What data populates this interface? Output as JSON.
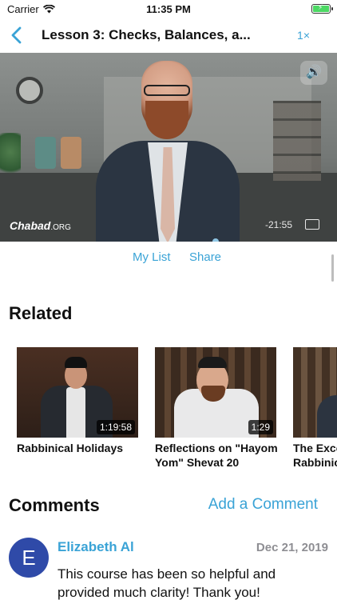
{
  "status_bar": {
    "carrier": "Carrier",
    "time": "11:35 PM",
    "icons": [
      "wifi-icon",
      "battery-charging-icon"
    ],
    "battery_color": "#4cd964"
  },
  "nav": {
    "title": "Lesson 3: Checks, Balances, a...",
    "speed": "1×",
    "back_icon": "chevron-left-icon"
  },
  "video": {
    "watermark": "Chabad",
    "watermark_suffix": ".ORG",
    "time_remaining": "-21:55",
    "icons": [
      "volume-icon",
      "airplay-icon"
    ]
  },
  "actions": {
    "my_list": "My List",
    "share": "Share"
  },
  "related": {
    "title": "Related",
    "items": [
      {
        "title": "Rabbinical Holidays",
        "duration": "1:19:58"
      },
      {
        "title": "Reflections on \"Hayom Yom\" Shevat 20",
        "duration": "1:29"
      },
      {
        "title": "The Exceptional Rabbinic...",
        "duration": ""
      }
    ]
  },
  "comments": {
    "title": "Comments",
    "add_label": "Add a Comment",
    "items": [
      {
        "initial": "E",
        "author": "Elizabeth Al",
        "date": "Dec 21, 2019",
        "text": "This course has been so helpful and provided much clarity! Thank you!"
      }
    ]
  },
  "colors": {
    "accent": "#3aa3d6",
    "avatar": "#2f4aa8",
    "muted": "#8e8e93"
  }
}
